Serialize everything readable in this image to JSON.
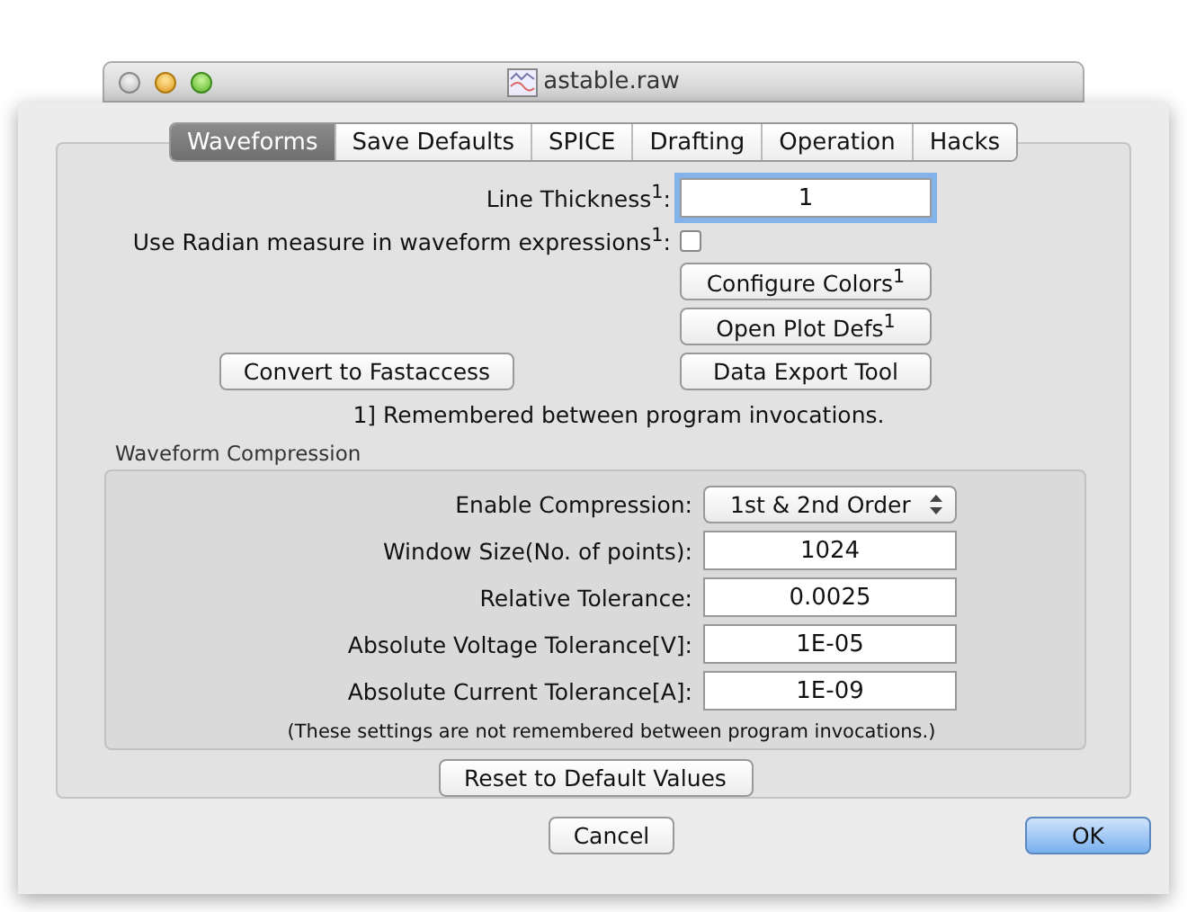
{
  "window": {
    "title": "astable.raw"
  },
  "tabs": [
    {
      "label": "Waveforms",
      "selected": true
    },
    {
      "label": "Save Defaults",
      "selected": false
    },
    {
      "label": "SPICE",
      "selected": false
    },
    {
      "label": "Drafting",
      "selected": false
    },
    {
      "label": "Operation",
      "selected": false
    },
    {
      "label": "Hacks",
      "selected": false
    }
  ],
  "settings": [
    {
      "kind": "field",
      "label": "Line Thickness$^{1}$:",
      "value": "1",
      "focused": true
    },
    {
      "kind": "checkbox",
      "label": "Use Radian measure in waveform expressions$^{1}$:",
      "checked": false
    },
    {
      "kind": "button",
      "label": "Configure Colors$^{1}$"
    },
    {
      "kind": "button",
      "label": "Open Plot Defs$^{1}$"
    },
    {
      "kind": "button",
      "label": "Data Export Tool",
      "side_button": "Convert to Fastaccess"
    }
  ],
  "note": "1] Remembered between program invocations.",
  "compression": {
    "title": "Waveform Compression",
    "rows": [
      {
        "kind": "dropdown",
        "label": "Enable Compression:",
        "value": "1st & 2nd Order"
      },
      {
        "kind": "field",
        "label": "Window Size(No. of points):",
        "value": "1024"
      },
      {
        "kind": "field",
        "label": "Relative Tolerance:",
        "value": "0.0025"
      },
      {
        "kind": "field",
        "label": "Absolute Voltage Tolerance[V]:",
        "value": "1E-05"
      },
      {
        "kind": "field",
        "label": "Absolute Current Tolerance[A]:",
        "value": "1E-09"
      }
    ],
    "note": "(These settings are not remembered between program invocations.)"
  },
  "reset_button": "Reset to Default Values",
  "buttons": [
    {
      "label": "Cancel",
      "default": false
    },
    {
      "label": "OK",
      "default": true
    }
  ]
}
